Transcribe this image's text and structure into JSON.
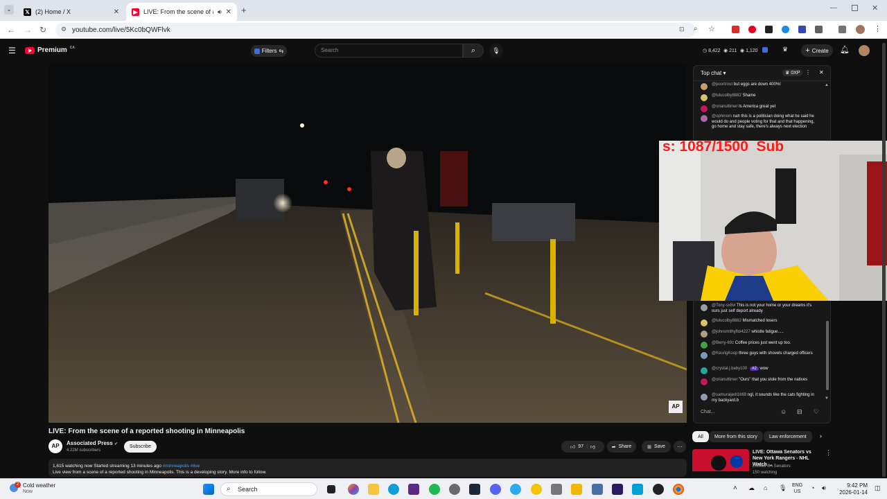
{
  "browser": {
    "tabs": [
      {
        "title": "(2) Home / X",
        "icon": "x-logo-icon"
      },
      {
        "title": "LIVE: From the scene of a re",
        "icon": "youtube-icon"
      }
    ],
    "url": "youtube.com/live/5Kc0bQWFlvk"
  },
  "youtube": {
    "logo_label": "Premium",
    "logo_region": "CA",
    "filters_label": "Filters",
    "search_placeholder": "Search",
    "stats": {
      "a": "8,422",
      "b": "211",
      "c": "1,120"
    },
    "create_label": "Create"
  },
  "video": {
    "title": "LIVE: From the scene of a reported shooting in Minneapolis",
    "watermark": "AP",
    "channel": {
      "avatar": "AP",
      "name": "Associated Press",
      "subs": "4.22M subscribers",
      "subscribe_label": "Subscribe"
    },
    "actions": {
      "likes": "97",
      "share": "Share",
      "save": "Save"
    },
    "description": {
      "line1_stats": "1,615 watching now  Started streaming 13 minutes ago",
      "line1_tags": "#minneapolis #live",
      "line2": "Live view from a scene of a reported shooting in Minneapolis. This is a developing story. More info to follow."
    }
  },
  "chat": {
    "header": "Top chat",
    "xp": "0XP",
    "input_placeholder": "Chat...",
    "messages_top": [
      {
        "user": "@poortrout",
        "text": "but eggs are down 400%!",
        "color": "#c8a06a"
      },
      {
        "user": "@lulucolby8882",
        "text": "Shame",
        "color": "#d7c46a"
      },
      {
        "user": "@orianultimer",
        "text": "Is America great yet",
        "color": "#c2185b"
      },
      {
        "user": "@ophinom",
        "text": "nah this is a politician doing what he said he would do and people voting for that and that happening, go home and stay safe, there's always next election",
        "color": "#a86aa0"
      }
    ],
    "messages_bottom": [
      {
        "user": "@Tony-sx8vl",
        "text": "This is not your home or your dreams it's ours just self deport already",
        "color": "#9e9e9e"
      },
      {
        "user": "@lulucolby8882",
        "text": "Mismatched losers",
        "color": "#d7c46a"
      },
      {
        "user": "@johnsmithyfloi4227",
        "text": "whistle fatigue.....",
        "color": "#b0a080"
      },
      {
        "user": "@Berry-69z",
        "text": "Coffee prices just went up too.",
        "color": "#43a047"
      },
      {
        "user": "@KeurigKoop",
        "text": "three guys with shovels charged officers",
        "color": "#7a9ab8"
      },
      {
        "user": "@crystal.j.baby100",
        "text": "wow",
        "badge": "#2",
        "color": "#26a69a"
      },
      {
        "user": "@orianultimer",
        "text": "\"Ours\" that you stole from the natives",
        "color": "#c2185b"
      },
      {
        "user": "@samuraijedi1669",
        "text": "ngl, it sounds like the cats fighting in my backyard.b",
        "color": "#8d9bb5"
      }
    ]
  },
  "overlay": {
    "counter_text": "s: 1087/1500  Sub"
  },
  "recommendations": {
    "chips": [
      "All",
      "More from this story",
      "Law enforcement"
    ],
    "item": {
      "title": "LIVE: Ottawa Senators vs New York Rangers - NHL Watch ...",
      "channel": "Locked On Senators",
      "views": "150 watching"
    }
  },
  "taskbar": {
    "weather_title": "Cold weather",
    "weather_sub": "Now",
    "weather_badge": "2",
    "search_label": "Search",
    "lang": "ENG",
    "region": "US",
    "time": "9:42 PM",
    "date": "2026-01-14"
  }
}
